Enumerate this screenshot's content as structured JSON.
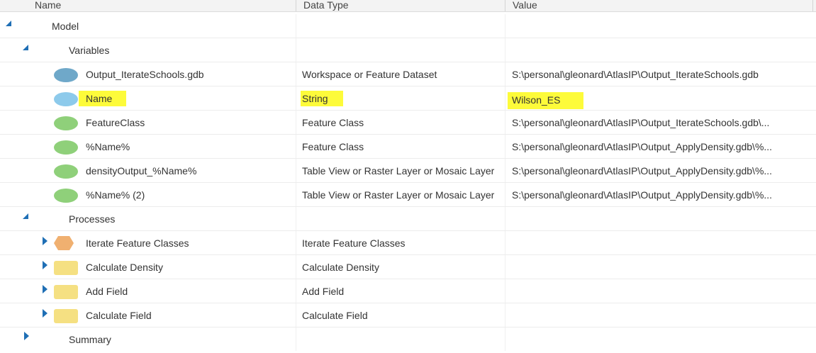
{
  "columns": {
    "name": "Name",
    "data_type": "Data Type",
    "value": "Value"
  },
  "rows": {
    "model": {
      "name": "Model"
    },
    "variables": {
      "name": "Variables"
    },
    "output_gdb": {
      "name": "Output_IterateSchools.gdb",
      "data_type": "Workspace or Feature Dataset",
      "value": "S:\\personal\\gleonard\\AtlasIP\\Output_IterateSchools.gdb",
      "icon": "workspace-ellipse-icon"
    },
    "name_var": {
      "name": "Name",
      "data_type": "String",
      "value": "Wilson_ES",
      "icon": "string-variable-ellipse-icon",
      "highlighted": true
    },
    "feature_class": {
      "name": "FeatureClass",
      "data_type": "Feature Class",
      "value": "S:\\personal\\gleonard\\AtlasIP\\Output_IterateSchools.gdb\\...",
      "icon": "derived-data-ellipse-icon"
    },
    "pct_name": {
      "name": "%Name%",
      "data_type": "Feature Class",
      "value": "S:\\personal\\gleonard\\AtlasIP\\Output_ApplyDensity.gdb\\%...",
      "icon": "derived-data-ellipse-icon"
    },
    "density_output": {
      "name": "densityOutput_%Name%",
      "data_type": "Table View or Raster Layer or Mosaic Layer",
      "value": "S:\\personal\\gleonard\\AtlasIP\\Output_ApplyDensity.gdb\\%...",
      "icon": "derived-data-ellipse-icon"
    },
    "pct_name_2": {
      "name": "%Name% (2)",
      "data_type": "Table View or Raster Layer or Mosaic Layer",
      "value": "S:\\personal\\gleonard\\AtlasIP\\Output_ApplyDensity.gdb\\%...",
      "icon": "derived-data-ellipse-icon"
    },
    "processes": {
      "name": "Processes"
    },
    "iterate_fc": {
      "name": "Iterate Feature Classes",
      "data_type": "Iterate Feature Classes",
      "icon": "iterator-hexagon-icon"
    },
    "calc_density": {
      "name": "Calculate Density",
      "data_type": "Calculate Density",
      "icon": "tool-rectangle-icon"
    },
    "add_field": {
      "name": "Add Field",
      "data_type": "Add Field",
      "icon": "tool-rectangle-icon"
    },
    "calc_field": {
      "name": "Calculate Field",
      "data_type": "Calculate Field",
      "icon": "tool-rectangle-icon"
    },
    "summary": {
      "name": "Summary"
    }
  },
  "colors": {
    "expander": "#1f6fb5",
    "workspace": "#6fa8c9",
    "string_variable": "#8dcaeb",
    "derived_data": "#8fd07a",
    "iterator": "#f0b070",
    "tool": "#f5e082",
    "highlight": "#fdfb3a"
  }
}
